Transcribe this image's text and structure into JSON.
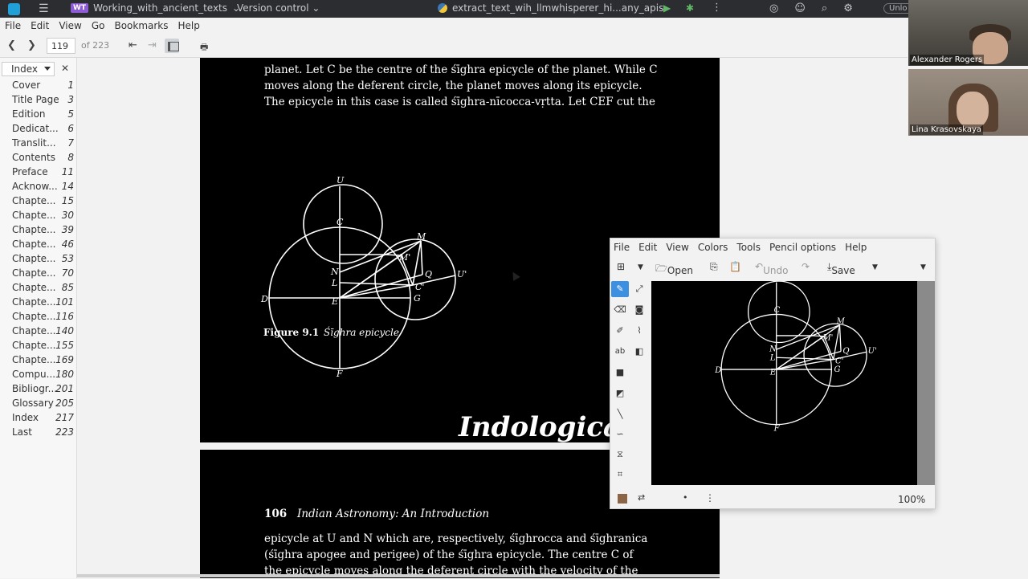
{
  "ide": {
    "project_badge": "WT",
    "project": "Working_with_ancient_texts",
    "vcs": "Version control",
    "run_config": "extract_text_wih_llmwhisperer_hi...any_apis",
    "unlock": "Unlo"
  },
  "menu": [
    "File",
    "Edit",
    "View",
    "Go",
    "Bookmarks",
    "Help"
  ],
  "toolbar": {
    "page_number": "119",
    "page_total": "of 223"
  },
  "sidebar": {
    "mode": "Index",
    "items": [
      {
        "label": "Cover",
        "page": "1"
      },
      {
        "label": "Title Page",
        "page": "3"
      },
      {
        "label": "Edition",
        "page": "5"
      },
      {
        "label": "Dedicat...",
        "page": "6"
      },
      {
        "label": "Translit...",
        "page": "7"
      },
      {
        "label": "Contents",
        "page": "8"
      },
      {
        "label": "Preface",
        "page": "11"
      },
      {
        "label": "Acknow...",
        "page": "14"
      },
      {
        "label": "Chapte...",
        "page": "15"
      },
      {
        "label": "Chapte...",
        "page": "30"
      },
      {
        "label": "Chapte...",
        "page": "39"
      },
      {
        "label": "Chapte...",
        "page": "46"
      },
      {
        "label": "Chapte...",
        "page": "53"
      },
      {
        "label": "Chapte...",
        "page": "70"
      },
      {
        "label": "Chapte...",
        "page": "85"
      },
      {
        "label": "Chapte...",
        "page": "101"
      },
      {
        "label": "Chapte...",
        "page": "116"
      },
      {
        "label": "Chapte...",
        "page": "140"
      },
      {
        "label": "Chapte...",
        "page": "155"
      },
      {
        "label": "Chapte...",
        "page": "169"
      },
      {
        "label": "Compu...",
        "page": "180"
      },
      {
        "label": "Bibliogr...",
        "page": "201"
      },
      {
        "label": "Glossary",
        "page": "205"
      },
      {
        "label": "Index",
        "page": "217"
      },
      {
        "label": "Last",
        "page": "223"
      }
    ]
  },
  "page1": {
    "lines": [
      "planet. Let C be the centre of the śīghra epicycle of the planet. While C",
      "moves along the deferent circle, the planet moves along its epicycle.",
      "The epicycle in this case is called śīghra-nīcocca-vṛtta. Let CEF cut the"
    ],
    "figure_number": "Figure 9.1",
    "figure_caption": "Śīghra epicycle",
    "watermark": "Indologica"
  },
  "page2": {
    "page_number": "106",
    "running_title": "Indian Astronomy: An Introduction",
    "lines": [
      "epicycle at U and N which are, respectively, śīghrocca and śīghranica",
      "(śīghra apogee and perigee) of the śīghra epicycle. The centre C of",
      "the epicycle moves along the deferent circle with the velocity of the"
    ]
  },
  "diagram_labels": [
    "U",
    "C",
    "M",
    "M'",
    "N",
    "L",
    "Q",
    "U'",
    "D",
    "E",
    "C'",
    "G",
    "F"
  ],
  "drawing_app": {
    "menu": [
      "File",
      "Edit",
      "View",
      "Colors",
      "Tools",
      "Pencil options",
      "Help"
    ],
    "open_label": "Open",
    "undo_label": "Undo",
    "save_label": "Save",
    "zoom": "100%",
    "primary_color": "#8c6446"
  },
  "video": [
    {
      "name": "Alexander Rogers"
    },
    {
      "name": "Lina Krasovskaya"
    }
  ]
}
